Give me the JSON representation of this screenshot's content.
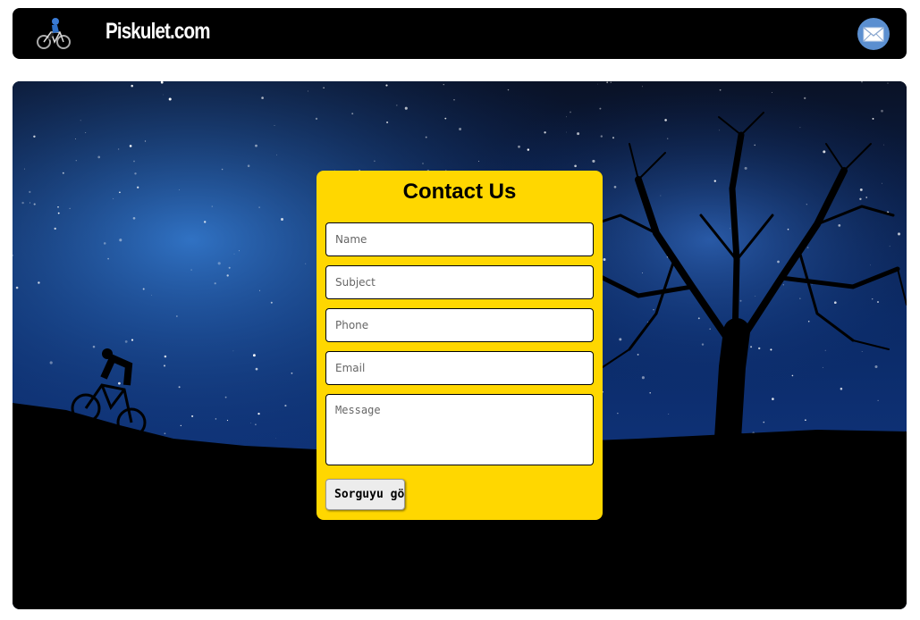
{
  "header": {
    "brand": "Piskulet.com",
    "logo_icon": "cyclist-icon",
    "mail_icon": "mail-icon"
  },
  "contact_form": {
    "title": "Contact Us",
    "name_placeholder": "Name",
    "subject_placeholder": "Subject",
    "phone_placeholder": "Phone",
    "email_placeholder": "Email",
    "message_placeholder": "Message",
    "submit_label": "Sorguyu gönder"
  },
  "colors": {
    "form_background": "#ffd700",
    "header_background": "#000000",
    "mail_button": "#5b8fd0"
  }
}
